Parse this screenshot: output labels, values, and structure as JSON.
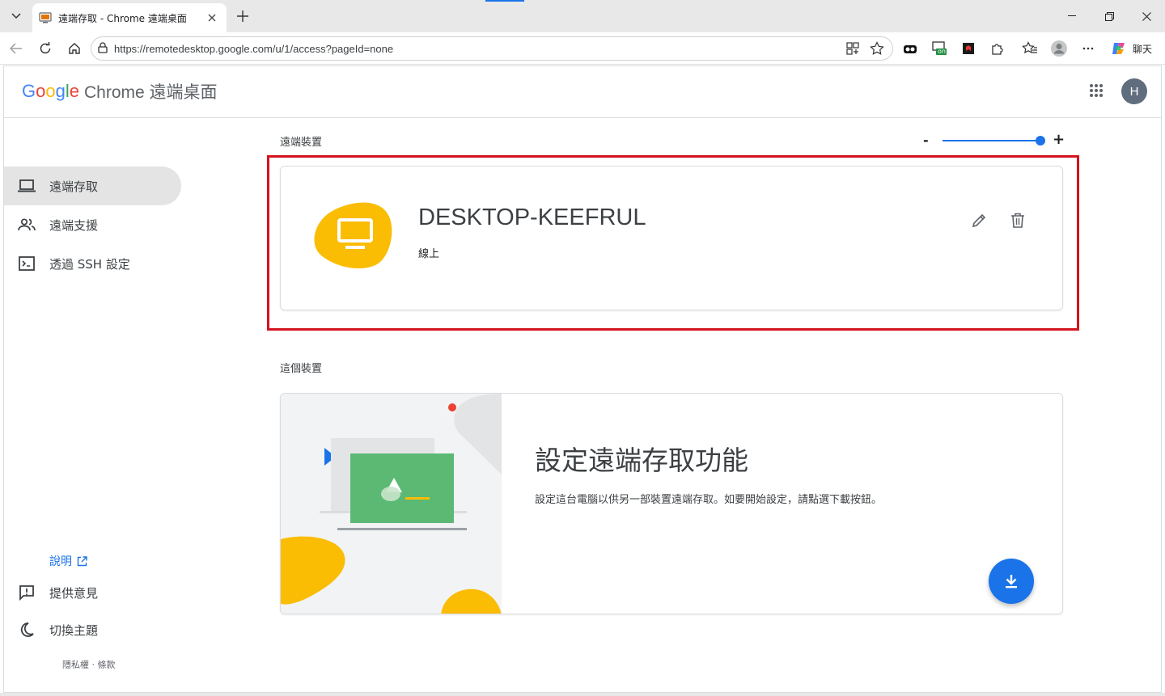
{
  "browser": {
    "tab_title": "遠端存取 - Chrome 遠端桌面",
    "url": "https://remotedesktop.google.com/u/1/access?pageId=none",
    "copilot_label": "聊天",
    "ext_on_badge": "on"
  },
  "app": {
    "logo_google": [
      "G",
      "o",
      "o",
      "g",
      "l",
      "e"
    ],
    "logo_google_colors": [
      "#4285F4",
      "#EA4335",
      "#FBBC05",
      "#4285F4",
      "#34A853",
      "#EA4335"
    ],
    "product_name": "Chrome 遠端桌面",
    "avatar_initial": "H"
  },
  "sidebar": {
    "items": [
      {
        "label": "遠端存取",
        "icon": "laptop-icon",
        "active": true
      },
      {
        "label": "遠端支援",
        "icon": "people-icon",
        "active": false
      },
      {
        "label": "透過 SSH 設定",
        "icon": "terminal-icon",
        "active": false
      }
    ],
    "help": "說明",
    "bottom_items": [
      {
        "label": "提供意見",
        "icon": "feedback-icon"
      },
      {
        "label": "切換主題",
        "icon": "moon-icon"
      }
    ],
    "footer": "隱私權 · 條款"
  },
  "main": {
    "remote_devices_title": "遠端裝置",
    "zoom": {
      "minus": "-",
      "plus": "+",
      "level": 1.0
    },
    "device": {
      "name": "DESKTOP-KEEFRUL",
      "status": "線上"
    },
    "this_device_title": "這個裝置",
    "setup": {
      "title": "設定遠端存取功能",
      "description": "設定這台電腦以供另一部裝置遠端存取。如要開始設定，請點選下載按鈕。"
    }
  },
  "colors": {
    "accent": "#1a73e8",
    "device_blob": "#fbbc04",
    "highlight": "#d3141e",
    "illustration_green": "#5bb974"
  }
}
